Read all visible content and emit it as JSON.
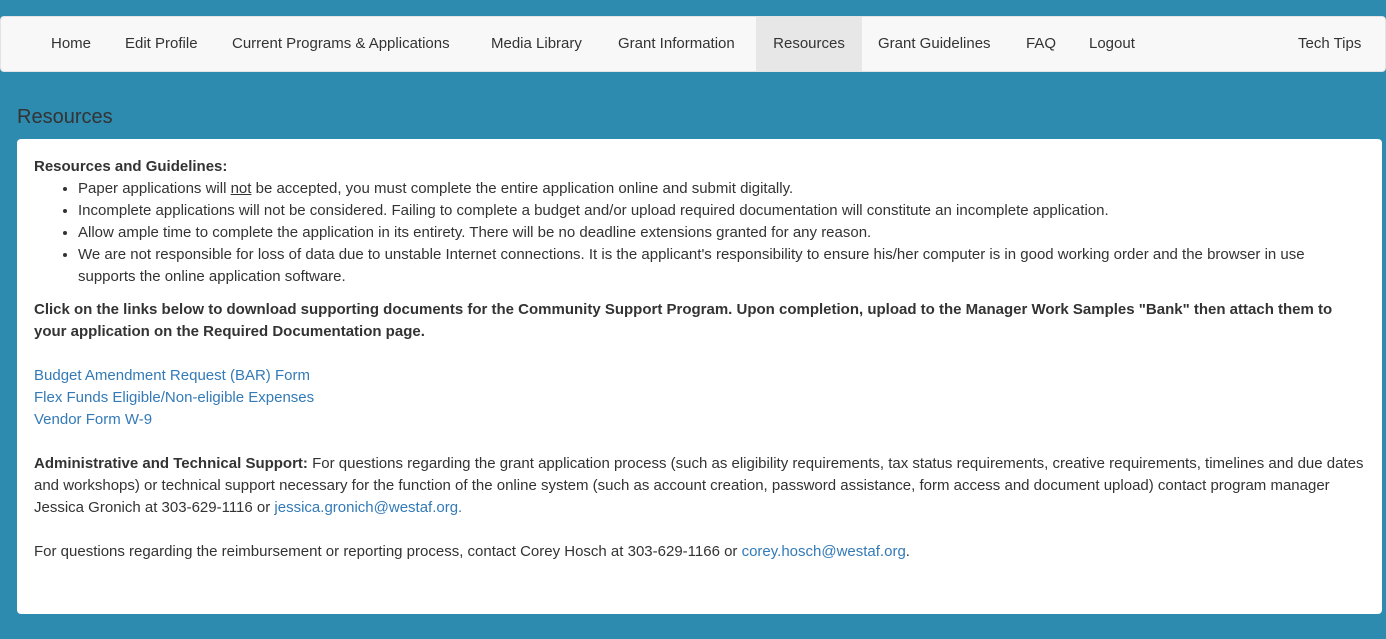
{
  "nav": {
    "items": [
      {
        "label": "Home"
      },
      {
        "label": "Edit Profile"
      },
      {
        "label": "Current Programs & Applications"
      },
      {
        "label": "Media Library"
      },
      {
        "label": "Grant Information"
      },
      {
        "label": "Resources"
      },
      {
        "label": "Grant Guidelines"
      },
      {
        "label": "FAQ"
      },
      {
        "label": "Logout"
      }
    ],
    "right_label": "Tech Tips",
    "active": "Resources"
  },
  "page": {
    "title": "Resources"
  },
  "guidelines": {
    "heading": "Resources and Guidelines:",
    "item1_pre": "Paper applications will ",
    "item1_emph": "not",
    "item1_post": " be accepted, you must complete the entire application online and submit digitally.",
    "item2": "Incomplete applications will not be considered. Failing to complete a budget and/or upload required documentation will constitute an incomplete application.",
    "item3": "Allow ample time to complete the application in its entirety. There will be no deadline extensions granted for any reason.",
    "item4": "We are not responsible for loss of data due to unstable Internet connections. It is the applicant's responsibility to ensure his/her computer is in good working order and the browser in use supports the online application software."
  },
  "instructions": "Click on the links below to download supporting documents for the Community Support Program. Upon completion, upload to the Manager Work Samples \"Bank\" then attach them to your application on the Required Documentation page.",
  "links": [
    {
      "label": "Budget Amendment Request (BAR) Form"
    },
    {
      "label": "Flex Funds Eligible/Non-eligible Expenses"
    },
    {
      "label": "Vendor Form W-9"
    }
  ],
  "support": {
    "heading": "Administrative and Technical Support:",
    "text": " For questions regarding the grant application process (such as eligibility requirements, tax status requirements, creative requirements, timelines and due dates and workshops) or technical support necessary for the function of the online system (such as account creation, password assistance, form access and document upload) contact program manager Jessica Gronich at 303-629-1116 or ",
    "email": "jessica.gronich@westaf.org."
  },
  "reimbursement": {
    "text": "For questions regarding the reimbursement or reporting process, contact Corey Hosch at 303-629-1166 or ",
    "email": "corey.hosch@westaf.org",
    "suffix": "."
  },
  "colors": {
    "background": "#2e8bb0",
    "link": "#337ab7",
    "navbar": "#f8f8f8",
    "active_tab": "#e7e7e7"
  }
}
